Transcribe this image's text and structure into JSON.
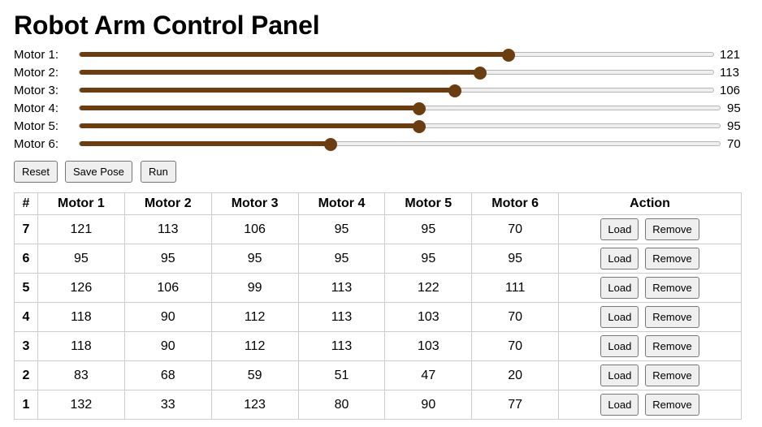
{
  "title": "Robot Arm Control Panel",
  "motors": [
    {
      "label": "Motor 1:",
      "value": 121,
      "fraction": 0.675
    },
    {
      "label": "Motor 2:",
      "value": 113,
      "fraction": 0.63
    },
    {
      "label": "Motor 3:",
      "value": 106,
      "fraction": 0.591
    },
    {
      "label": "Motor 4:",
      "value": 95,
      "fraction": 0.529
    },
    {
      "label": "Motor 5:",
      "value": 95,
      "fraction": 0.529
    },
    {
      "label": "Motor 6:",
      "value": 70,
      "fraction": 0.391
    }
  ],
  "buttons": {
    "reset": "Reset",
    "save_pose": "Save Pose",
    "run": "Run"
  },
  "table": {
    "headers": [
      "#",
      "Motor 1",
      "Motor 2",
      "Motor 3",
      "Motor 4",
      "Motor 5",
      "Motor 6",
      "Action"
    ],
    "load_label": "Load",
    "remove_label": "Remove",
    "rows": [
      [
        "7",
        "121",
        "113",
        "106",
        "95",
        "95",
        "70"
      ],
      [
        "6",
        "95",
        "95",
        "95",
        "95",
        "95",
        "95"
      ],
      [
        "5",
        "126",
        "106",
        "99",
        "113",
        "122",
        "111"
      ],
      [
        "4",
        "118",
        "90",
        "112",
        "113",
        "103",
        "70"
      ],
      [
        "3",
        "118",
        "90",
        "112",
        "113",
        "103",
        "70"
      ],
      [
        "2",
        "83",
        "68",
        "59",
        "51",
        "47",
        "20"
      ],
      [
        "1",
        "132",
        "33",
        "123",
        "80",
        "90",
        "77"
      ]
    ]
  },
  "colors": {
    "slider_fill": "#6b3e12",
    "track": "#efefef"
  }
}
